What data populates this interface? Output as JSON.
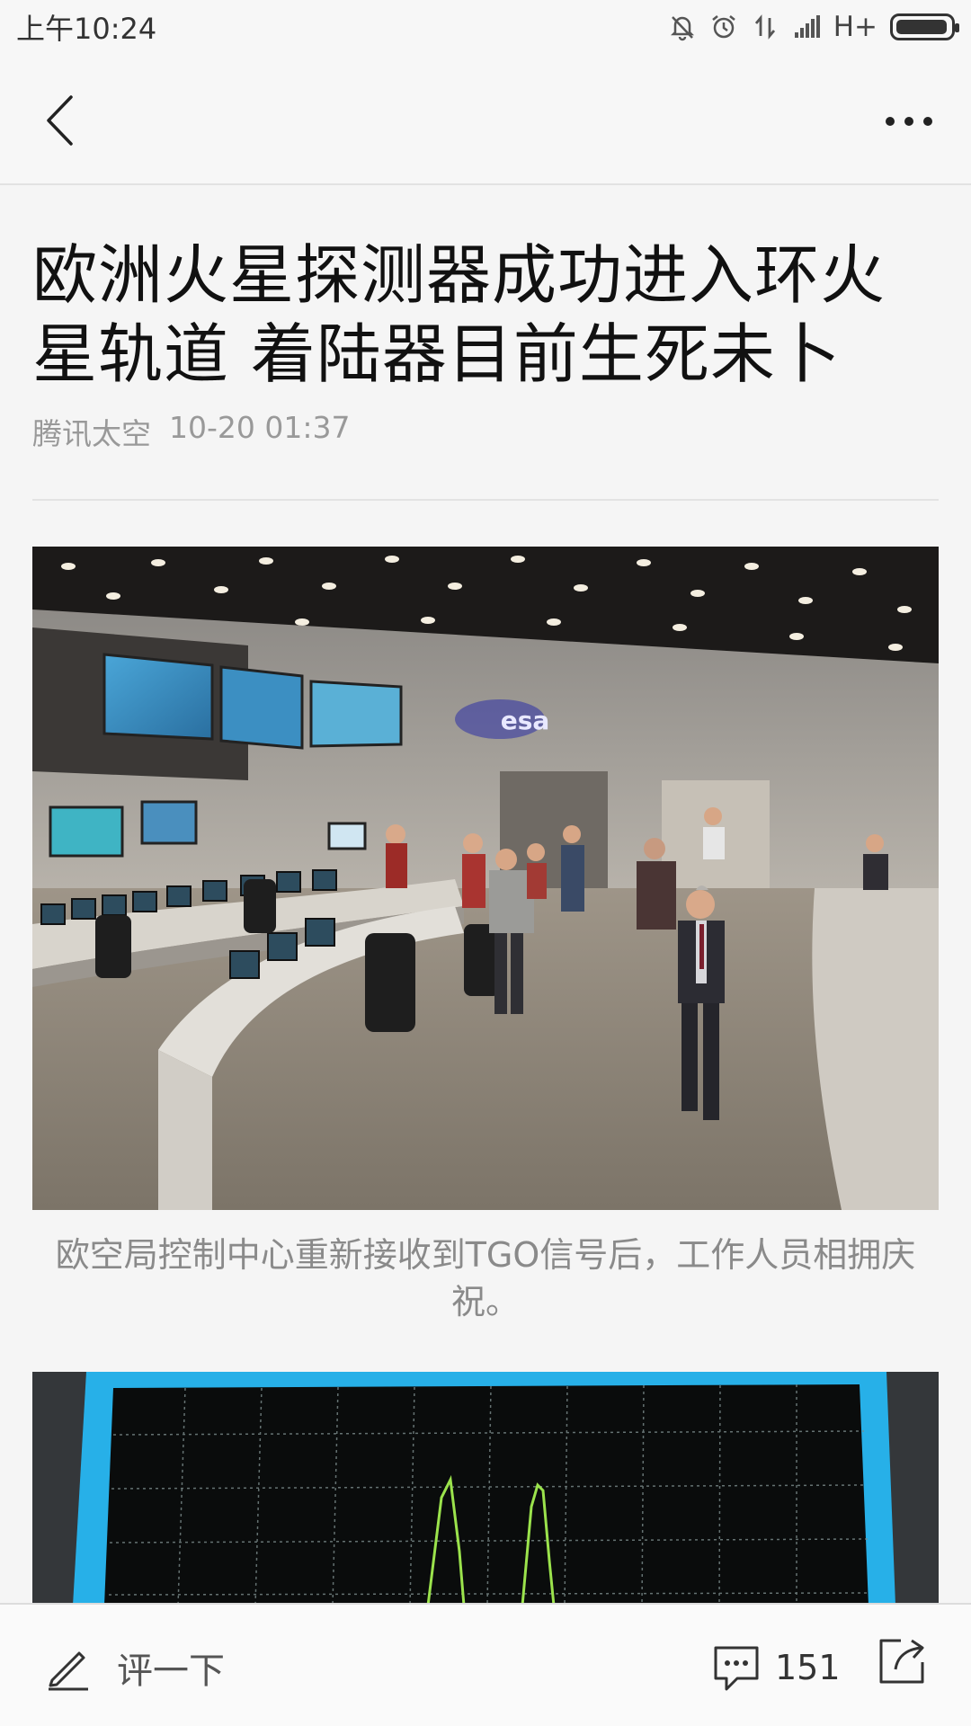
{
  "status_bar": {
    "time": "上午10:24",
    "network": "H+",
    "icons": [
      "mute-bell-icon",
      "alarm-icon",
      "data-transfer-icon",
      "signal-icon",
      "battery-icon"
    ]
  },
  "nav": {
    "icons": [
      "back-chevron-icon",
      "more-dots-icon"
    ]
  },
  "article": {
    "title": "欧洲火星探测器成功进入环火星轨道 着陆器目前生死未卜",
    "source": "腾讯太空",
    "datetime": "10-20 01:37",
    "images": [
      {
        "caption": "欧空局控制中心重新接收到TGO信号后，工作人员相拥庆祝。",
        "sign_text": "esa"
      },
      {
        "caption": ""
      }
    ]
  },
  "bottom_bar": {
    "comment_placeholder": "评一下",
    "comment_count": "151",
    "icons": [
      "pen-icon",
      "comment-bubble-icon",
      "share-icon"
    ]
  },
  "colors": {
    "background": "#f5f5f5",
    "title_text": "#111111",
    "meta_text": "#999999",
    "caption_text": "#8a8a8a"
  }
}
